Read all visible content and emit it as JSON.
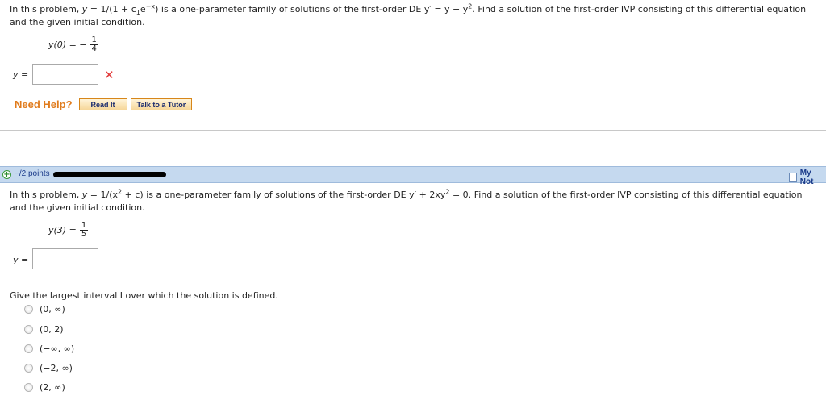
{
  "problem1": {
    "text_line1_a": "In this problem,",
    "text_line1_mid": "is a one-parameter family of solutions of the first-order DE",
    "text_line1_b": "Find a solution of the first-order IVP consisting of this differential equation",
    "text_line2": "and the given initial condition.",
    "family_y": "y",
    "family_rest": " = 1/(1 + c",
    "family_sub": "1",
    "family_e": "e",
    "family_sup": "−x",
    "family_close": ")",
    "de": "y′ = y − y",
    "de_sup": "2",
    "de_end": ".",
    "condition_lhs": "y(0) = −",
    "condition_num": "1",
    "condition_den": "4",
    "answer_label": "y =",
    "answer_value": "",
    "incorrect_mark": "✕"
  },
  "help": {
    "label": "Need Help?",
    "read_it": "Read It",
    "talk_to_tutor": "Talk to a Tutor"
  },
  "problem2_header": {
    "points": "−/2 points",
    "my_notes": "My Not"
  },
  "problem2": {
    "text_line1_a": "In this problem,",
    "family_y": "y",
    "family_rest": " = 1/(x",
    "family_sup": "2",
    "family_close": " + c)",
    "text_line1_mid": "is a one-parameter family of solutions of the first-order DE",
    "de_a": "y′ + 2xy",
    "de_sup": "2",
    "de_b": " = 0.",
    "text_line1_b": "Find a solution of the first-order IVP consisting of this differential equation",
    "text_line2": "and the given initial condition.",
    "condition_lhs": "y(3) =",
    "condition_num": "1",
    "condition_den": "5",
    "answer_label": "y =",
    "answer_value": "",
    "interval_question": "Give the largest interval I over which the solution is defined.",
    "options": [
      "(0, ∞)",
      "(0, 2)",
      "(−∞, ∞)",
      "(−2, ∞)",
      "(2, ∞)"
    ]
  }
}
